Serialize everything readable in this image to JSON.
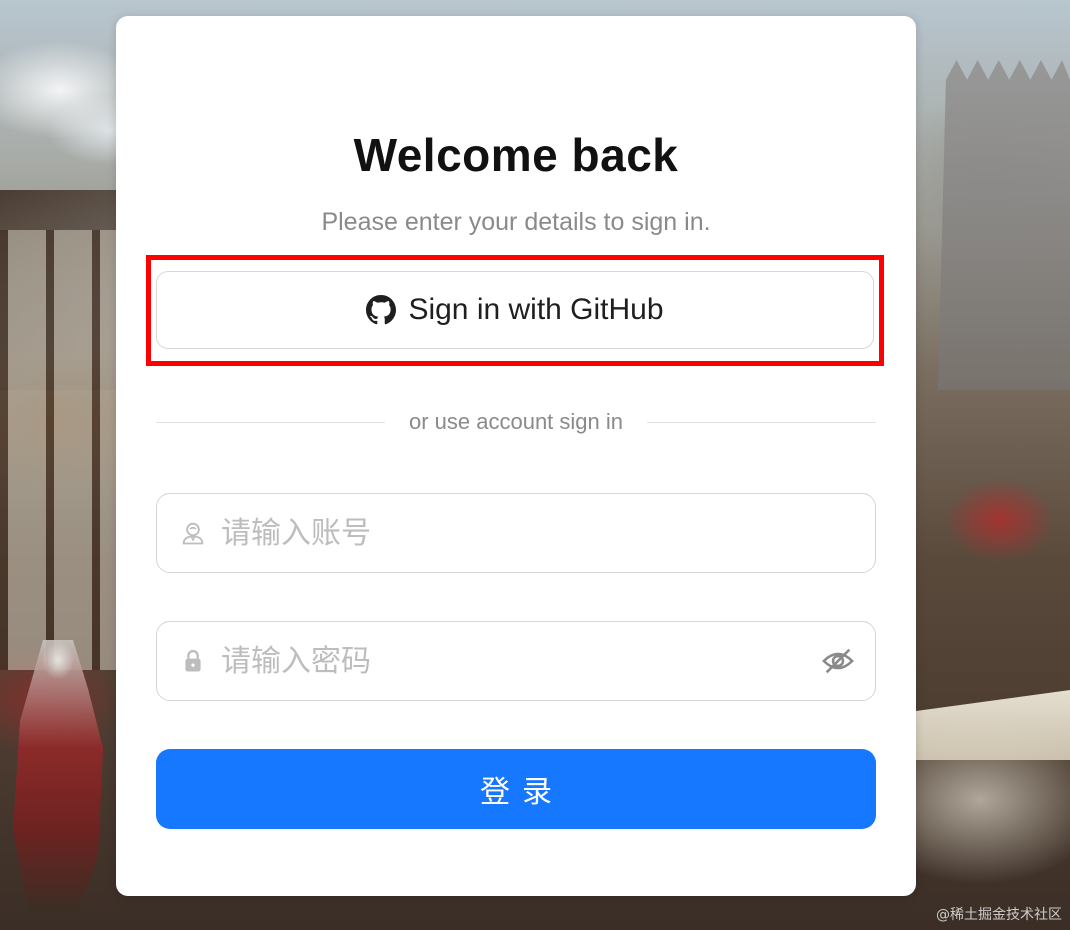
{
  "background": {
    "watermark": "@稀土掘金技术社区"
  },
  "card": {
    "title": "Welcome back",
    "subtitle": "Please enter your details to sign in."
  },
  "github_button": {
    "label": "Sign in with GitHub",
    "icon": "github-icon"
  },
  "divider": {
    "text": "or use account sign in"
  },
  "account_input": {
    "placeholder": "请输入账号",
    "value": "",
    "icon": "user-icon"
  },
  "password_input": {
    "placeholder": "请输入密码",
    "value": "",
    "icon": "lock-icon",
    "toggle_icon": "eye-slash-icon"
  },
  "login_button": {
    "label": "登录"
  },
  "colors": {
    "primary": "#1677ff",
    "highlight": "#ff0000"
  }
}
